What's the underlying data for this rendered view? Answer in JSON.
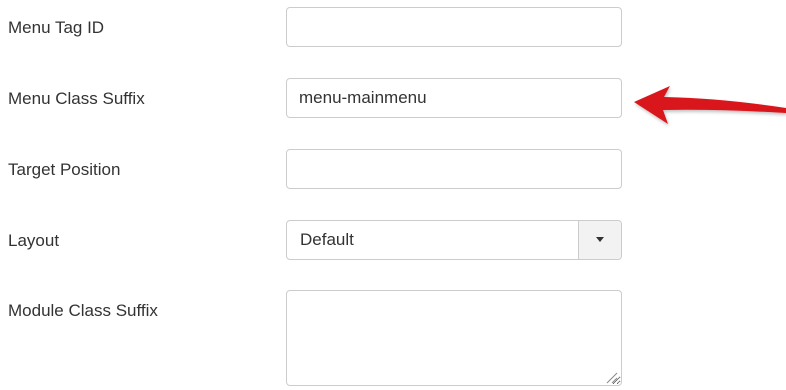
{
  "form": {
    "menu_tag_id": {
      "label": "Menu Tag ID",
      "value": ""
    },
    "menu_class_suffix": {
      "label": "Menu Class Suffix",
      "value": "menu-mainmenu"
    },
    "target_position": {
      "label": "Target Position",
      "value": ""
    },
    "layout": {
      "label": "Layout",
      "selected": "Default"
    },
    "module_class_suffix": {
      "label": "Module Class Suffix",
      "value": ""
    }
  },
  "annotation": {
    "arrow_color": "#d9141b",
    "icon": "red-pointer-arrow-icon"
  },
  "colors": {
    "text": "#333333",
    "border": "#cccccc",
    "caret_bg": "#f2f2f2"
  }
}
